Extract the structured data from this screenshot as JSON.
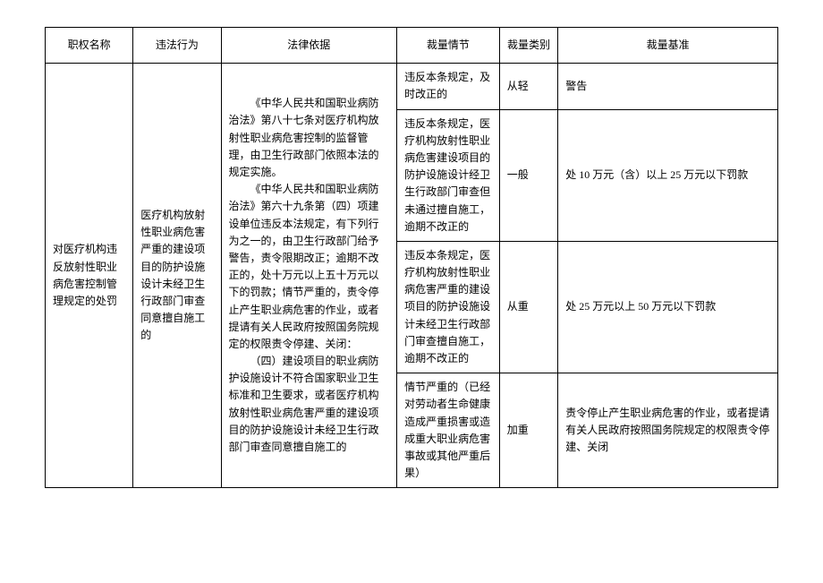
{
  "headers": {
    "col1": "职权名称",
    "col2": "违法行为",
    "col3": "法律依据",
    "col4": "裁量情节",
    "col5": "裁量类别",
    "col6": "裁量基准"
  },
  "authority_name": "对医疗机构违反放射性职业病危害控制管理规定的处罚",
  "illegal_act": "医疗机构放射性职业病危害严重的建设项目的防护设施设计未经卫生行政部门审查同意擅自施工的",
  "legal_basis_p1": "《中华人民共和国职业病防治法》第八十七条对医疗机构放射性职业病危害控制的监督管理，由卫生行政部门依照本法的规定实施。",
  "legal_basis_p2": "《中华人民共和国职业病防治法》第六十九条第（四）项建设单位违反本法规定，有下列行为之一的，由卫生行政部门给予警告，责令限期改正；逾期不改正的，处十万元以上五十万元以下的罚款；情节严重的，责令停止产生职业病危害的作业，或者提请有关人民政府按照国务院规定的权限责令停建、关闭：",
  "legal_basis_p3": "（四）建设项目的职业病防护设施设计不符合国家职业卫生标准和卫生要求，或者医疗机构放射性职业病危害严重的建设项目的防护设施设计未经卫生行政部门审查同意擅自施工的",
  "rows": [
    {
      "circumstance": "违反本条规定，及时改正的",
      "category": "从轻",
      "standard": "警告"
    },
    {
      "circumstance": "违反本条规定，医疗机构放射性职业病危害建设项目的防护设施设计经卫生行政部门审查但未通过擅自施工，逾期不改正的",
      "category": "一般",
      "standard": "处 10 万元（含）以上 25 万元以下罚款"
    },
    {
      "circumstance": "违反本条规定，医疗机构放射性职业病危害严重的建设项目的防护设施设计未经卫生行政部门审查擅自施工，逾期不改正的",
      "category": "从重",
      "standard": "处 25 万元以上 50 万元以下罚款"
    },
    {
      "circumstance": "情节严重的（已经对劳动者生命健康造成严重损害或造成重大职业病危害事故或其他严重后果）",
      "category": "加重",
      "standard": "责令停止产生职业病危害的作业，或者提请有关人民政府按照国务院规定的权限责令停建、关闭"
    }
  ]
}
